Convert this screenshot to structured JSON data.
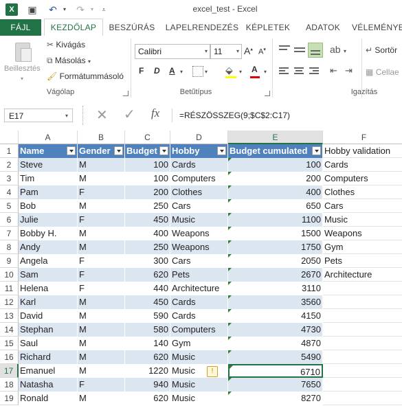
{
  "titlebar": {
    "logo": "X",
    "doc_title": "excel_test - Excel",
    "icons": [
      "save-icon",
      "undo-icon",
      "redo-icon",
      "customize-qat-icon"
    ],
    "undo_glyph": "↶",
    "redo_glyph": "↷",
    "save_glyph": "▣"
  },
  "tabs": [
    "FÁJL",
    "KEZDŐLAP",
    "BESZÚRÁS",
    "LAPELRENDEZÉS",
    "KÉPLETEK",
    "ADATOK",
    "VÉLEMÉNYE"
  ],
  "ribbon": {
    "clipboard": {
      "paste": "Beillesztés",
      "cut": "Kivágás",
      "copy": "Másolás",
      "format_painter": "Formátummásoló",
      "label": "Vágólap"
    },
    "font": {
      "font_name": "Calibri",
      "font_size": "11",
      "grow": "A",
      "shrink": "A",
      "bold": "F",
      "italic": "D",
      "underline": "A",
      "font_color": "A",
      "label": "Betűtípus"
    },
    "alignment": {
      "label": "Igazítás"
    },
    "editing": {
      "sort": "Sortör",
      "cells": "Cellae"
    }
  },
  "formula_bar": {
    "name_box": "E17",
    "cancel": "✕",
    "enter": "✓",
    "fx": "fx",
    "formula": "=RÉSZÖSSZEG(9;$C$2:C17)"
  },
  "columns": [
    "A",
    "B",
    "C",
    "D",
    "E",
    "F"
  ],
  "selected_column": "E",
  "selected_row": "17",
  "table_headers": [
    "Name",
    "Gender",
    "Budget",
    "Hobby",
    "Budget cumulated"
  ],
  "validation_header": "Hobby validation",
  "rows": [
    {
      "row": "2",
      "name": "Steve",
      "gender": "M",
      "budget": "100",
      "hobby": "Cards",
      "cum": "100",
      "val": "Cards"
    },
    {
      "row": "3",
      "name": "Tim",
      "gender": "M",
      "budget": "100",
      "hobby": "Computers",
      "cum": "200",
      "val": "Computers"
    },
    {
      "row": "4",
      "name": "Pam",
      "gender": "F",
      "budget": "200",
      "hobby": "Clothes",
      "cum": "400",
      "val": "Clothes"
    },
    {
      "row": "5",
      "name": "Bob",
      "gender": "M",
      "budget": "250",
      "hobby": "Cars",
      "cum": "650",
      "val": "Cars"
    },
    {
      "row": "6",
      "name": "Julie",
      "gender": "F",
      "budget": "450",
      "hobby": "Music",
      "cum": "1100",
      "val": "Music"
    },
    {
      "row": "7",
      "name": "Bobby H.",
      "gender": "M",
      "budget": "400",
      "hobby": "Weapons",
      "cum": "1500",
      "val": "Weapons"
    },
    {
      "row": "8",
      "name": "Andy",
      "gender": "M",
      "budget": "250",
      "hobby": "Weapons",
      "cum": "1750",
      "val": "Gym"
    },
    {
      "row": "9",
      "name": "Angela",
      "gender": "F",
      "budget": "300",
      "hobby": "Cars",
      "cum": "2050",
      "val": "Pets"
    },
    {
      "row": "10",
      "name": "Sam",
      "gender": "F",
      "budget": "620",
      "hobby": "Pets",
      "cum": "2670",
      "val": "Architecture"
    },
    {
      "row": "11",
      "name": "Helena",
      "gender": "F",
      "budget": "440",
      "hobby": "Architecture",
      "cum": "3110",
      "val": ""
    },
    {
      "row": "12",
      "name": "Karl",
      "gender": "M",
      "budget": "450",
      "hobby": "Cards",
      "cum": "3560",
      "val": ""
    },
    {
      "row": "13",
      "name": "David",
      "gender": "M",
      "budget": "590",
      "hobby": "Cards",
      "cum": "4150",
      "val": ""
    },
    {
      "row": "14",
      "name": "Stephan",
      "gender": "M",
      "budget": "580",
      "hobby": "Computers",
      "cum": "4730",
      "val": ""
    },
    {
      "row": "15",
      "name": "Saul",
      "gender": "M",
      "budget": "140",
      "hobby": "Gym",
      "cum": "4870",
      "val": ""
    },
    {
      "row": "16",
      "name": "Richard",
      "gender": "M",
      "budget": "620",
      "hobby": "Music",
      "cum": "5490",
      "val": ""
    },
    {
      "row": "17",
      "name": "Emanuel",
      "gender": "M",
      "budget": "1220",
      "hobby": "Music",
      "cum": "6710",
      "val": ""
    },
    {
      "row": "18",
      "name": "Natasha",
      "gender": "F",
      "budget": "940",
      "hobby": "Music",
      "cum": "7650",
      "val": ""
    },
    {
      "row": "19",
      "name": "Ronald",
      "gender": "M",
      "budget": "620",
      "hobby": "Music",
      "cum": "8270",
      "val": ""
    }
  ],
  "colors": {
    "accent": "#217346",
    "table_header": "#4f81bd",
    "band": "#dce6f1"
  }
}
